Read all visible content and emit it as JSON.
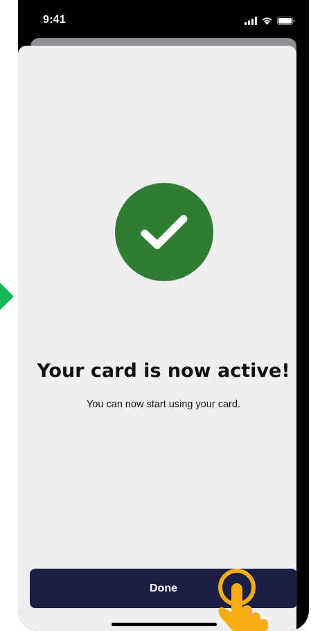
{
  "status_bar": {
    "time": "9:41",
    "icons": [
      "signal-icon",
      "wifi-icon",
      "battery-icon"
    ]
  },
  "success_screen": {
    "icon": "checkmark-icon",
    "title": "Your card is now active!",
    "subtitle": "You can now start using your card."
  },
  "actions": {
    "done_label": "Done"
  },
  "colors": {
    "success_green": "#2e7d32",
    "button_navy": "#1c1f44",
    "sheet_background": "#efeff2",
    "tap_cursor": "#f6ad14",
    "side_arrow": "#14b85a"
  }
}
